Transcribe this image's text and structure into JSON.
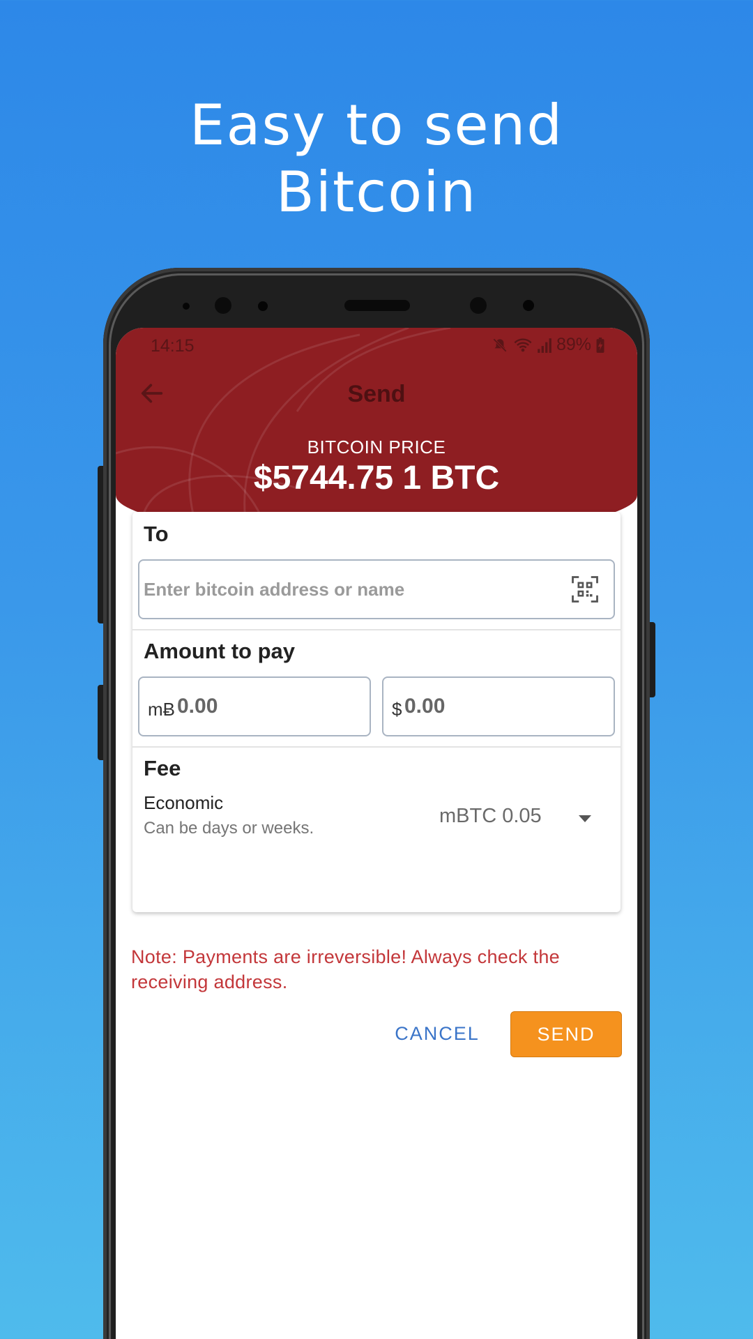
{
  "headline": {
    "line1": "Easy to send",
    "line2": "Bitcoin"
  },
  "status_bar": {
    "time": "14:15",
    "battery": "89%"
  },
  "header": {
    "title": "Send",
    "price_label": "BITCOIN PRICE",
    "price_value": "$5744.75 1 BTC"
  },
  "form": {
    "to": {
      "label": "To",
      "placeholder": "Enter bitcoin address or name"
    },
    "amount": {
      "label": "Amount to pay",
      "btc_prefix": "mɃ",
      "btc_value": "0.00",
      "usd_prefix": "$",
      "usd_value": "0.00"
    },
    "fee": {
      "label": "Fee",
      "type": "Economic",
      "description": "Can be days or weeks.",
      "selected": "mBTC 0.05"
    }
  },
  "note": "Note: Payments are irreversible! Always check the receiving address.",
  "actions": {
    "cancel": "CANCEL",
    "send": "SEND"
  },
  "colors": {
    "background_top": "#2d88e8",
    "header": "#8e1e22",
    "send_button": "#f5921e",
    "cancel_text": "#3a74c8",
    "note_text": "#c3373a"
  }
}
